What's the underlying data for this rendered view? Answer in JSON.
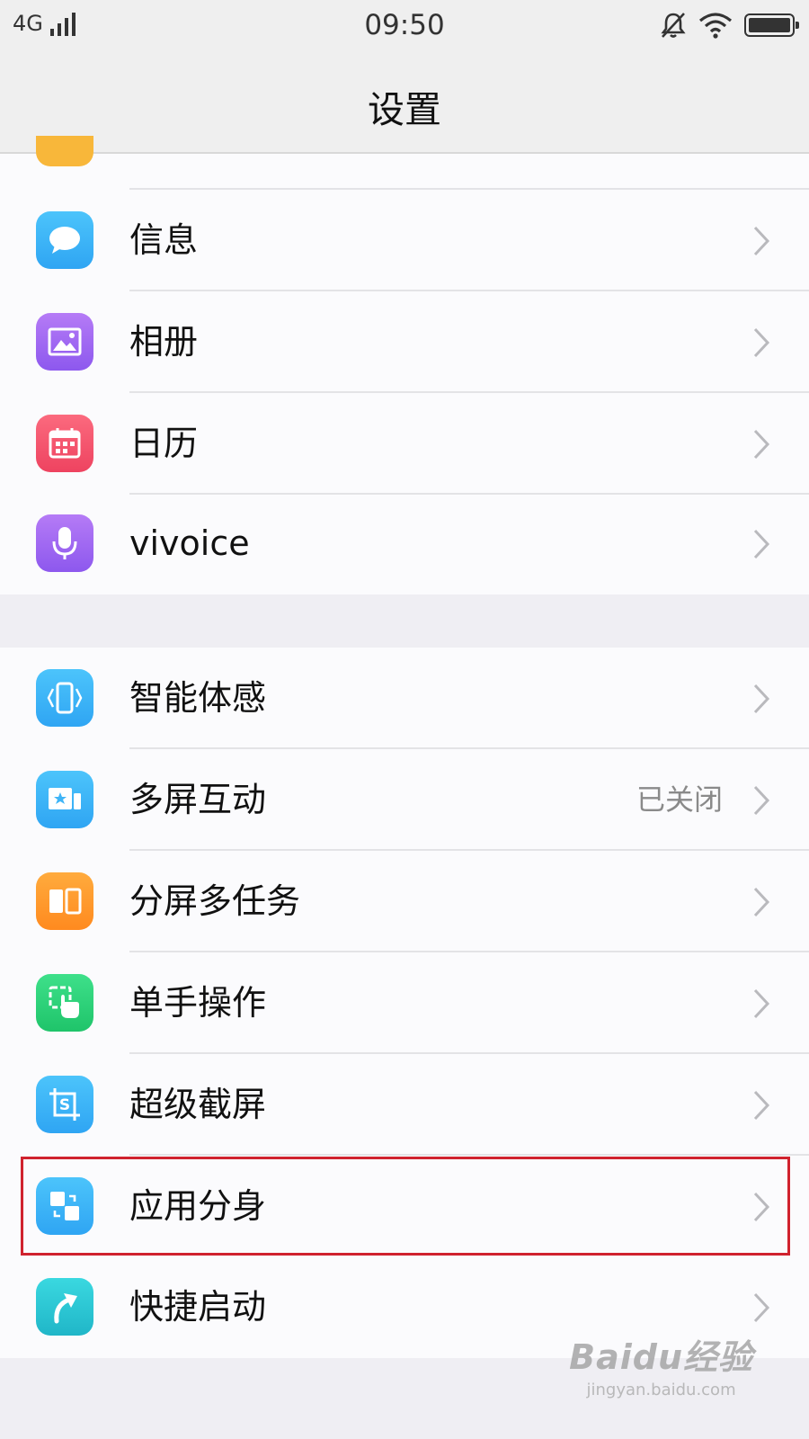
{
  "status_bar": {
    "network": "4G",
    "time": "09:50"
  },
  "header": {
    "title": "设置"
  },
  "group1": {
    "items": [
      {
        "label": "信息",
        "icon": "message-icon",
        "color": "#3fb6f8"
      },
      {
        "label": "相册",
        "icon": "photo-album-icon",
        "color": "#a36cf2"
      },
      {
        "label": "日历",
        "icon": "calendar-icon",
        "color": "#f4566f"
      },
      {
        "label": "vivoice",
        "icon": "microphone-icon",
        "color": "#a66cf2"
      }
    ]
  },
  "group2": {
    "items": [
      {
        "label": "智能体感",
        "icon": "motion-sensing-icon",
        "color": "#3fb5f7"
      },
      {
        "label": "多屏互动",
        "value": "已关闭",
        "icon": "multi-screen-icon",
        "color": "#3fb5f7"
      },
      {
        "label": "分屏多任务",
        "icon": "split-screen-icon",
        "color": "#ff9a2e"
      },
      {
        "label": "单手操作",
        "icon": "one-hand-icon",
        "color": "#2fd47a"
      },
      {
        "label": "超级截屏",
        "icon": "super-screenshot-icon",
        "color": "#3fb5f7"
      },
      {
        "label": "应用分身",
        "icon": "app-clone-icon",
        "color": "#3fb5f7"
      },
      {
        "label": "快捷启动",
        "icon": "quick-launch-icon",
        "color": "#2ec8d6"
      }
    ]
  },
  "watermark": {
    "main": "Baidu经验",
    "url": "jingyan.baidu.com"
  }
}
